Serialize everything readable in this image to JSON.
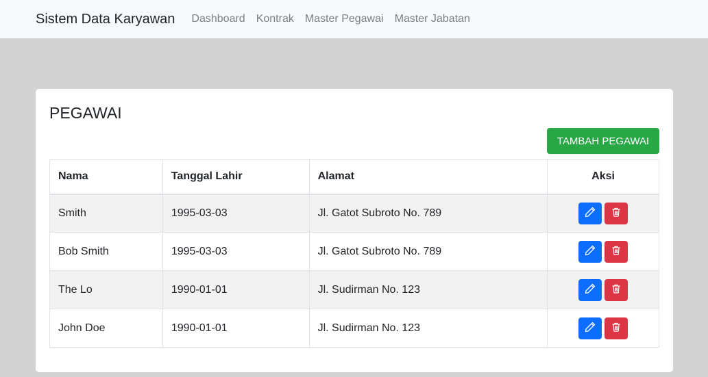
{
  "navbar": {
    "brand": "Sistem Data Karyawan",
    "links": [
      "Dashboard",
      "Kontrak",
      "Master Pegawai",
      "Master Jabatan"
    ]
  },
  "page": {
    "title": "PEGAWAI",
    "add_button": "TAMBAH PEGAWAI"
  },
  "table": {
    "headers": [
      "Nama",
      "Tanggal Lahir",
      "Alamat",
      "Aksi"
    ],
    "rows": [
      {
        "nama": "Smith",
        "tanggal_lahir": "1995-03-03",
        "alamat": "Jl. Gatot Subroto No. 789"
      },
      {
        "nama": "Bob Smith",
        "tanggal_lahir": "1995-03-03",
        "alamat": "Jl. Gatot Subroto No. 789"
      },
      {
        "nama": "The Lo",
        "tanggal_lahir": "1990-01-01",
        "alamat": "Jl. Sudirman No. 123"
      },
      {
        "nama": "John Doe",
        "tanggal_lahir": "1990-01-01",
        "alamat": "Jl. Sudirman No. 123"
      }
    ]
  },
  "icons": {
    "edit": "pencil-icon",
    "delete": "trash-icon"
  },
  "colors": {
    "success": "#28a745",
    "primary": "#0d6efd",
    "danger": "#dc3545",
    "background": "#d3d3d3"
  }
}
